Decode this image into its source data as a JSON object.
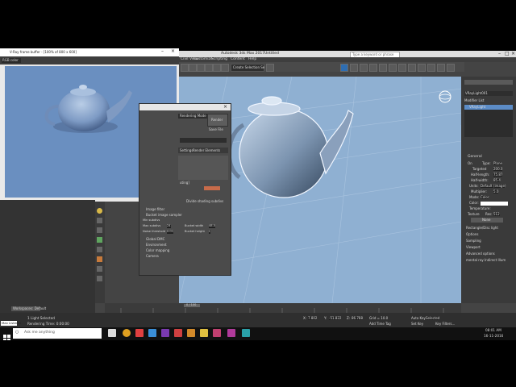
{
  "app": {
    "title": "Autodesk 3ds Max 2017",
    "doc": "Untitled",
    "search_placeholder": "Type a keyword or phrase"
  },
  "menu": [
    "Civil View",
    "Customize",
    "Scripting",
    "Content",
    "Help"
  ],
  "selection_set": "Create Selection Se",
  "vfb": {
    "title": "V-Ray frame buffer - [100% of 800 x 600]",
    "channel": "RGB color"
  },
  "viewport": {
    "label": "[+][Perspective][User Defined][Default Shading]"
  },
  "render_setup": {
    "title_suffix": "",
    "mode": "Rendering Mode",
    "render_btn": "Render",
    "save_file": "Save File",
    "tabs": [
      "Settings",
      "Render Elements"
    ],
    "rollouts": [
      "Image filter",
      "Bucket image sampler",
      "Global DMC",
      "Environment",
      "Color mapping",
      "Camera"
    ],
    "sampler_fields": [
      {
        "label": "Min subdivs",
        "value": "1"
      },
      {
        "label": "Max subdivs",
        "value": "24"
      },
      {
        "label": "Bucket width",
        "value": "48.0"
      },
      {
        "label": "Noise threshold",
        "value": "0.01"
      },
      {
        "label": "Bucket height",
        "value": "L"
      }
    ],
    "shade_label": "Divide shading subdivs",
    "dialog_suffix": "uting]"
  },
  "command_panel": {
    "object_name": "VRayLight001",
    "modifier_list": "Modifier List",
    "stack_item": "VRayLight",
    "general": "General",
    "on": "On",
    "type_label": "Type:",
    "type_value": "Plane",
    "targeted": "Targeted",
    "targeted_val": "200.0",
    "half_length": "Half-length:",
    "half_length_val": "75.87",
    "half_width": "Half-width:",
    "half_width_val": "85.4",
    "units": "Units:",
    "units_val": "Default (image)",
    "multiplier": "Multiplier:",
    "multiplier_val": "5.0",
    "mode": "Mode:",
    "mode_val": "Color",
    "color": "Color:",
    "temperature": "Temperature:",
    "texture": "Texture",
    "res": "Res:",
    "res_val": "512",
    "none": "None",
    "rollouts": [
      "Rectangle/Disc light",
      "Options",
      "Sampling",
      "Viewport",
      "Advanced options",
      "mental ray Indirect Illum"
    ]
  },
  "timeline": {
    "range": "0 / 100",
    "ticks": [
      "0",
      "10",
      "20",
      "30",
      "40",
      "50",
      "60",
      "70",
      "80",
      "90",
      "100"
    ]
  },
  "status": {
    "workspace": "Workspaces: Default",
    "maxscript": "Max Listener",
    "selected": "1 Light Selected",
    "rendering_time": "Rendering Time: 0:00:00",
    "x_label": "X:",
    "x_val": "7.802",
    "y_label": "Y:",
    "y_val": "-51.822",
    "z_label": "Z:",
    "z_val": "86.788",
    "grid": "Grid = 10.0",
    "autokey": "Auto Key",
    "selected_drop": "Selected",
    "set_key": "Set Key",
    "key_filters": "Key Filters...",
    "add_time_tag": "Add Time Tag"
  },
  "taskbar": {
    "search": "Ask me anything",
    "time": "08:01 AM",
    "date": "16-11-2016"
  },
  "colors": {
    "viewport": "#8fb0d2",
    "render_bg": "#6a8fc0",
    "accent": "#3d7fd1"
  }
}
